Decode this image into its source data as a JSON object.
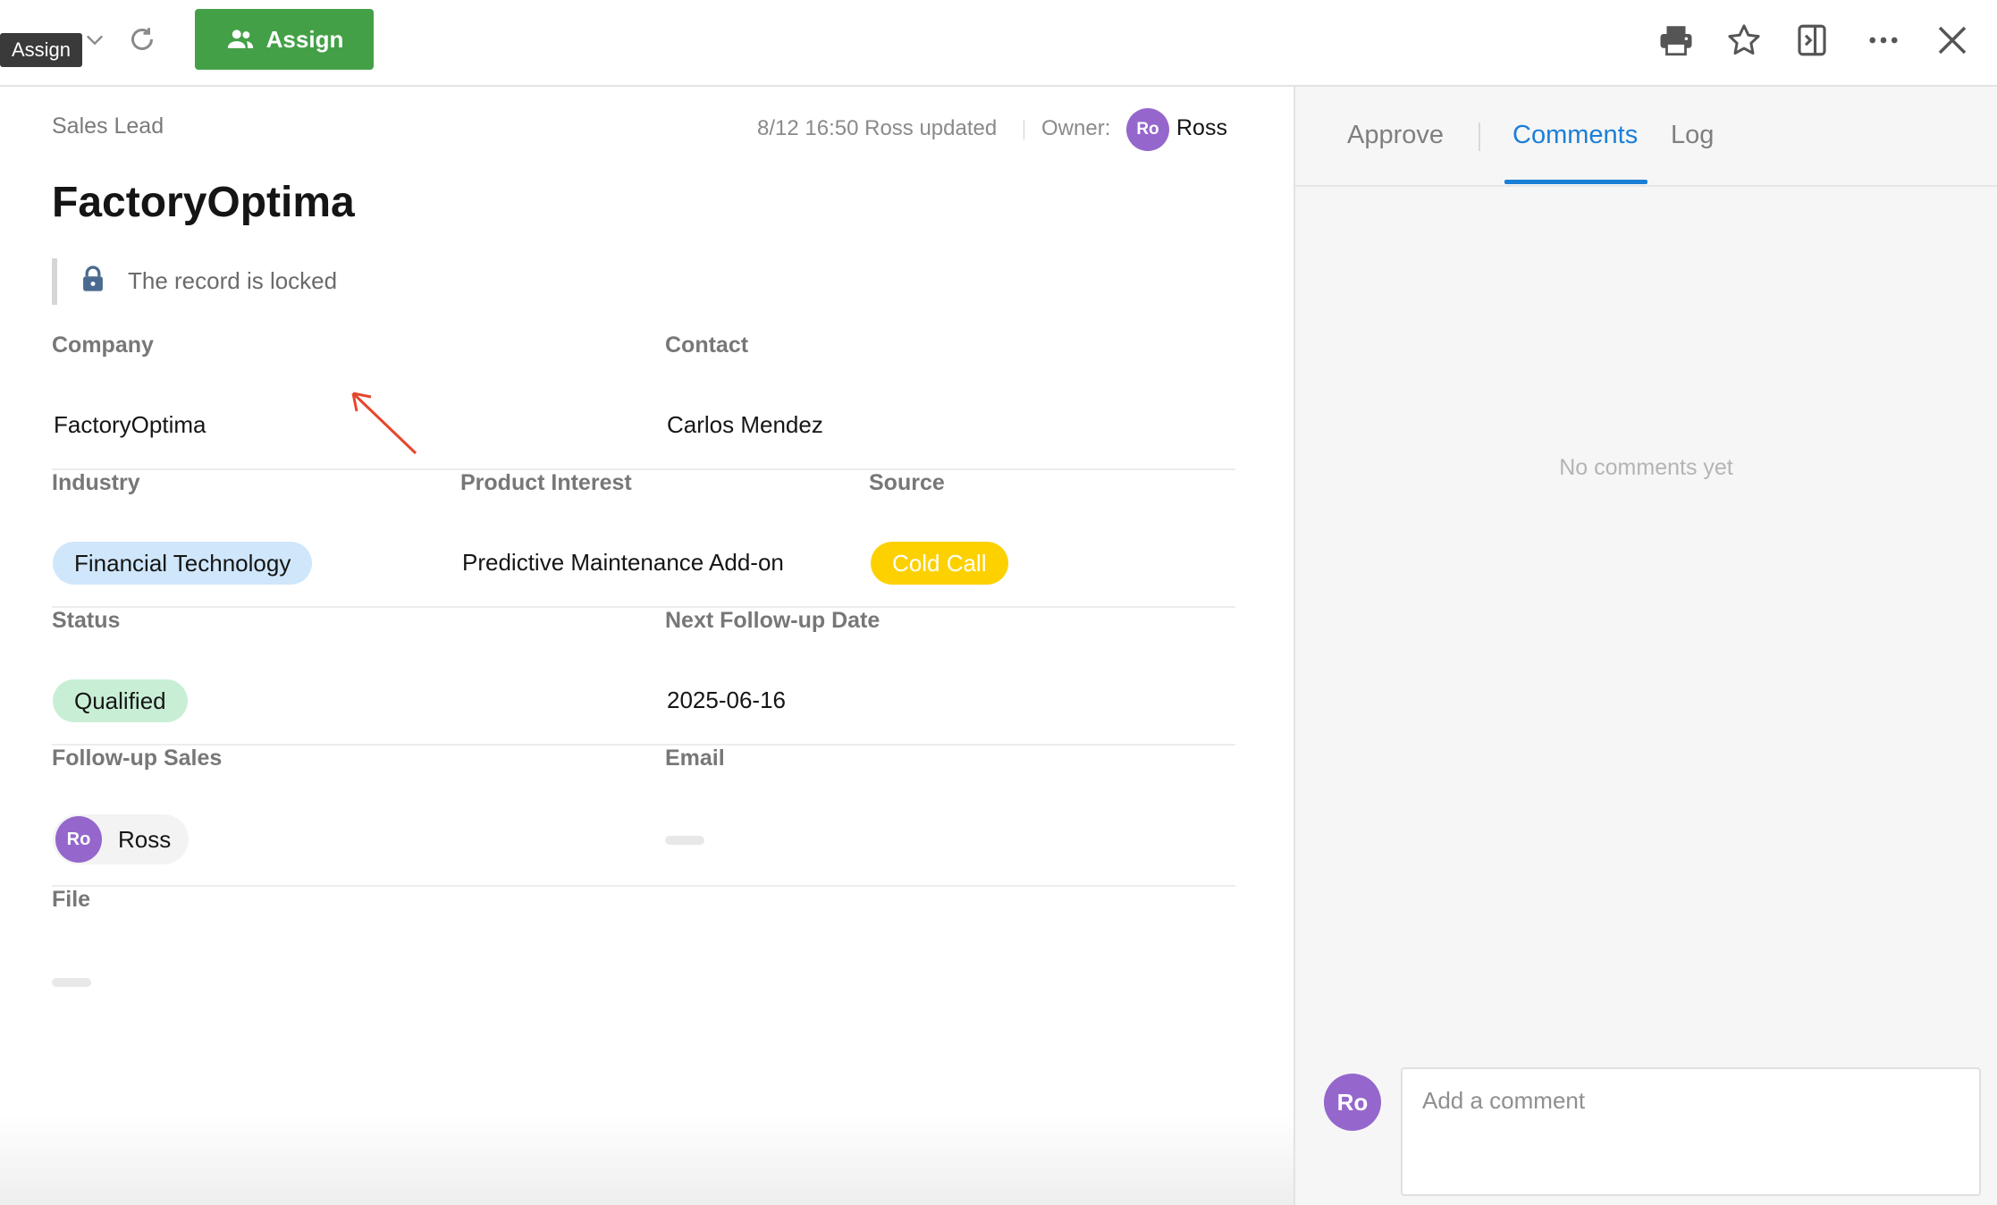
{
  "toolbar": {
    "tooltip": "Assign",
    "assign_label": "Assign",
    "icons": [
      "chevron-down-icon",
      "refresh-icon",
      "users-icon",
      "print-icon",
      "star-icon",
      "panel-toggle-icon",
      "more-icon",
      "close-icon"
    ],
    "assign_color": "#43a047"
  },
  "record": {
    "object_name": "Sales Lead",
    "updated_meta": "8/12 16:50 Ross updated",
    "owner_label": "Owner:",
    "owner_initials": "Ro",
    "owner_name": "Ross",
    "title": "FactoryOptima",
    "lock_text": "The record is locked"
  },
  "fields": {
    "company": {
      "label": "Company",
      "value": "FactoryOptima"
    },
    "contact": {
      "label": "Contact",
      "value": "Carlos Mendez"
    },
    "industry": {
      "label": "Industry",
      "value": "Financial Technology",
      "color": "#cfe6fb"
    },
    "product_interest": {
      "label": "Product Interest",
      "value": "Predictive Maintenance Add-on"
    },
    "source": {
      "label": "Source",
      "value": "Cold Call",
      "color": "#fdd100"
    },
    "status": {
      "label": "Status",
      "value": "Qualified",
      "color": "#c8efd5"
    },
    "next_follow_up": {
      "label": "Next Follow-up Date",
      "value": "2025-06-16"
    },
    "follow_up_sales": {
      "label": "Follow-up Sales",
      "initials": "Ro",
      "name": "Ross"
    },
    "email": {
      "label": "Email"
    },
    "file": {
      "label": "File"
    }
  },
  "panel": {
    "tabs": [
      "Approve",
      "Comments",
      "Log"
    ],
    "active_tab": "Comments",
    "accent": "#1b7fd6",
    "empty_text": "No comments yet",
    "commenter_initials": "Ro",
    "comment_placeholder": "Add a comment"
  }
}
